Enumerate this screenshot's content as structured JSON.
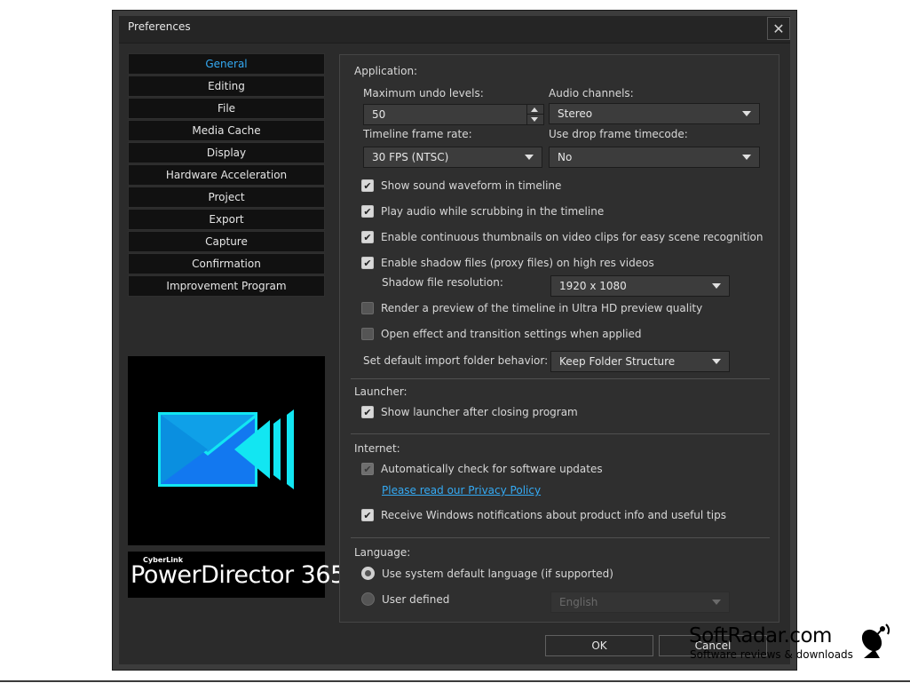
{
  "window": {
    "title": "Preferences",
    "close_symbol": "✕"
  },
  "sidebar": {
    "items": [
      {
        "label": "General",
        "active": true
      },
      {
        "label": "Editing"
      },
      {
        "label": "File"
      },
      {
        "label": "Media Cache"
      },
      {
        "label": "Display"
      },
      {
        "label": "Hardware Acceleration"
      },
      {
        "label": "Project"
      },
      {
        "label": "Export"
      },
      {
        "label": "Capture"
      },
      {
        "label": "Confirmation"
      },
      {
        "label": "Improvement Program"
      }
    ]
  },
  "brand": {
    "small": "CyberLink",
    "name": "PowerDirector 365"
  },
  "application": {
    "section": "Application:",
    "undo_label": "Maximum undo levels:",
    "undo_value": "50",
    "audio_label": "Audio channels:",
    "audio_value": "Stereo",
    "framerate_label": "Timeline frame rate:",
    "framerate_value": "30 FPS (NTSC)",
    "dropframe_label": "Use drop frame timecode:",
    "dropframe_value": "No",
    "opt_waveform": "Show sound waveform in timeline",
    "opt_scrub": "Play audio while scrubbing in the timeline",
    "opt_thumbnails": "Enable continuous thumbnails on video clips for easy scene recognition",
    "opt_shadow": "Enable shadow files (proxy files) on high res videos",
    "shadow_res_label": "Shadow file resolution:",
    "shadow_res_value": "1920 x 1080",
    "opt_uhd": "Render a preview of the timeline in Ultra HD preview quality",
    "opt_effect": "Open effect and transition settings when applied",
    "import_label": "Set default import folder behavior:",
    "import_value": "Keep Folder Structure"
  },
  "launcher": {
    "section": "Launcher:",
    "opt_show": "Show launcher after closing program"
  },
  "internet": {
    "section": "Internet:",
    "opt_updates": "Automatically check for software updates",
    "privacy_link": "Please read our Privacy Policy",
    "opt_notifications": "Receive Windows notifications about product info and useful tips"
  },
  "language": {
    "section": "Language:",
    "opt_system": "Use system default language (if supported)",
    "opt_user": "User defined",
    "user_value": "English"
  },
  "buttons": {
    "ok": "OK",
    "cancel": "Cancel"
  },
  "watermark": {
    "title": "SoftRadar.com",
    "subtitle": "Software reviews & downloads"
  },
  "colors": {
    "accent": "#34aaf4",
    "panel": "#2f2f2f",
    "logo_cyan": "#12e6f2",
    "logo_blue": "#1278f0"
  }
}
